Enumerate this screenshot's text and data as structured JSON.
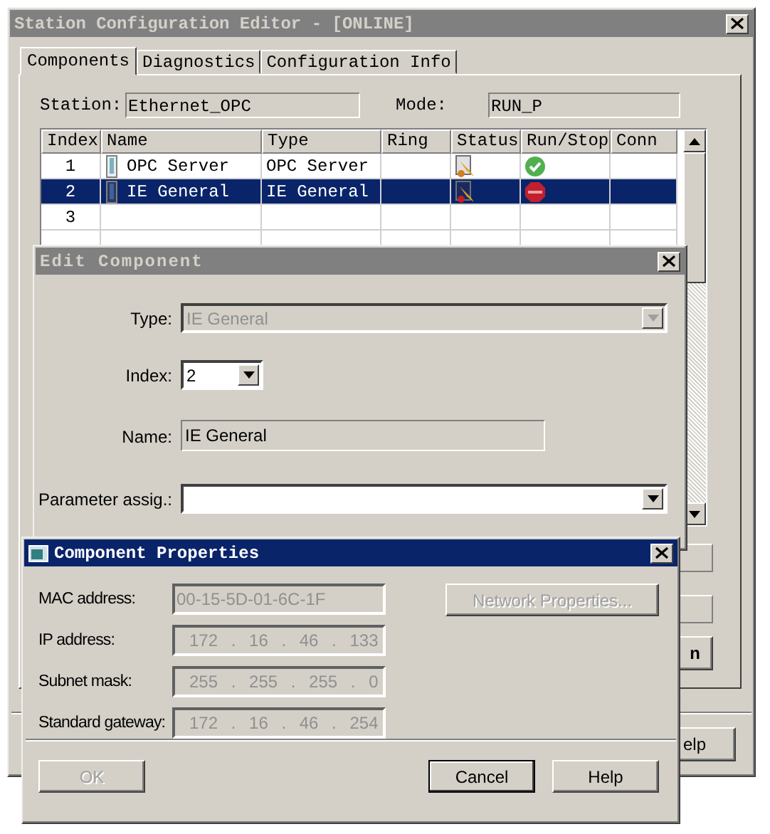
{
  "main_window": {
    "title": "Station Configuration Editor - [ONLINE]",
    "tabs": [
      {
        "label": "Components",
        "selected": true
      },
      {
        "label": "Diagnostics",
        "selected": false
      },
      {
        "label": "Configuration Info",
        "selected": false
      }
    ],
    "station_label": "Station:",
    "station": "Ethernet_OPC",
    "mode_label": "Mode:",
    "mode": "RUN_P",
    "table": {
      "columns": [
        "Index",
        "Name",
        "Type",
        "Ring",
        "Status",
        "Run/Stop",
        "Conn"
      ],
      "rows": [
        {
          "index": "1",
          "name": "OPC Server",
          "type": "OPC Server",
          "running": true,
          "selected": false
        },
        {
          "index": "2",
          "name": "IE General",
          "type": "IE General",
          "running": false,
          "selected": true
        },
        {
          "index": "3",
          "selected": false
        },
        {
          "selected": false
        }
      ]
    },
    "side_buttons": [
      "n"
    ],
    "help_button": "elp"
  },
  "edit_component": {
    "title": "Edit Component",
    "fields": [
      {
        "label": "Type:",
        "kind": "combo",
        "value": "IE General",
        "disabled": true
      },
      {
        "label": "Index:",
        "kind": "small_combo",
        "value": "2",
        "disabled": false
      },
      {
        "label": "Name:",
        "kind": "display",
        "value": "IE General",
        "disabled": false
      },
      {
        "label": "Parameter assig.:",
        "kind": "combo",
        "disabled": false
      }
    ]
  },
  "component_properties": {
    "title": "Component Properties",
    "fields": [
      {
        "label": "MAC address:",
        "kind": "text",
        "value": "00-15-5D-01-6C-1F",
        "disabled": true
      },
      {
        "label": "IP address:",
        "kind": "ip",
        "value": "172 . 16 . 46 . 133",
        "disabled": true
      },
      {
        "label": "Subnet mask:",
        "kind": "ip",
        "value": "255 . 255 . 255 . 0",
        "disabled": true
      },
      {
        "label": "Standard gateway:",
        "kind": "ip",
        "value": "172 . 16 . 46 . 254",
        "disabled": true
      }
    ],
    "network_button": {
      "label": "Network Properties...",
      "disabled": true
    },
    "buttons": [
      {
        "label": "OK",
        "disabled": true,
        "default": false
      },
      {
        "label": "Cancel",
        "disabled": false,
        "default": true
      },
      {
        "label": "Help",
        "disabled": false,
        "default": false
      }
    ]
  }
}
